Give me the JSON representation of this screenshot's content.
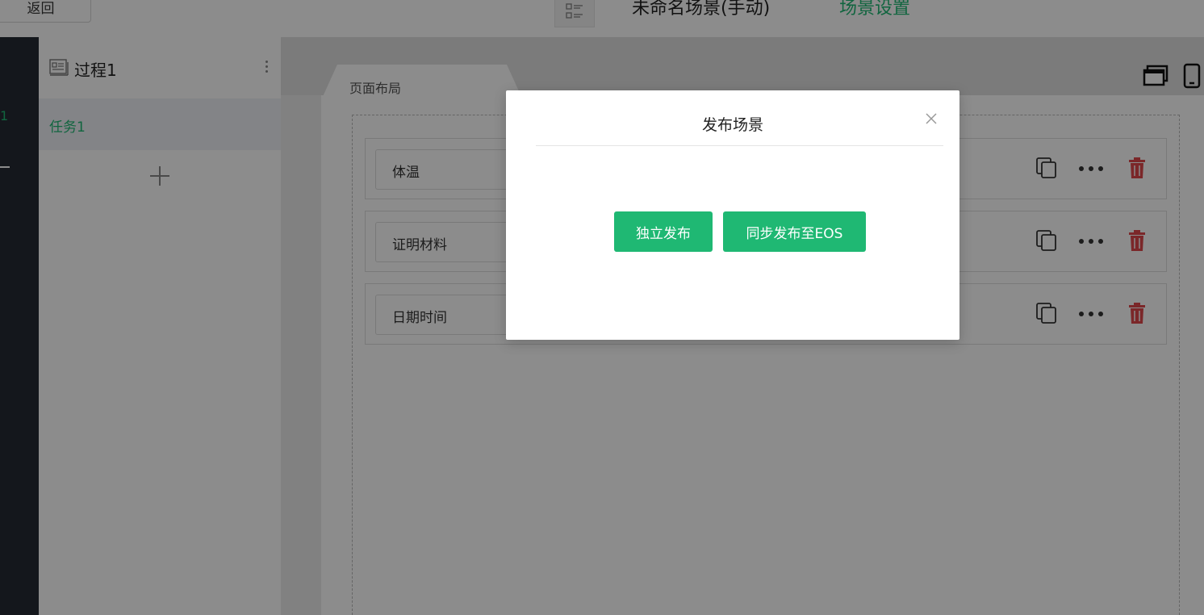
{
  "topbar": {
    "back_label": "返回",
    "scene_title": "未命名场景(手动)",
    "scene_settings_label": "场景设置"
  },
  "rail": {
    "active_number": "1"
  },
  "process": {
    "title": "过程1",
    "tasks": [
      {
        "label": "任务1"
      }
    ]
  },
  "canvas": {
    "tab_label": "页面布局",
    "fields": [
      {
        "label": "体温"
      },
      {
        "label": "证明材料"
      },
      {
        "label": "日期时间"
      }
    ]
  },
  "modal": {
    "title": "发布场景",
    "btn_independent": "独立发布",
    "btn_sync": "同步发布至EOS"
  },
  "colors": {
    "accent": "#1fb873",
    "danger": "#e0474c",
    "rail_bg": "#262a33"
  }
}
